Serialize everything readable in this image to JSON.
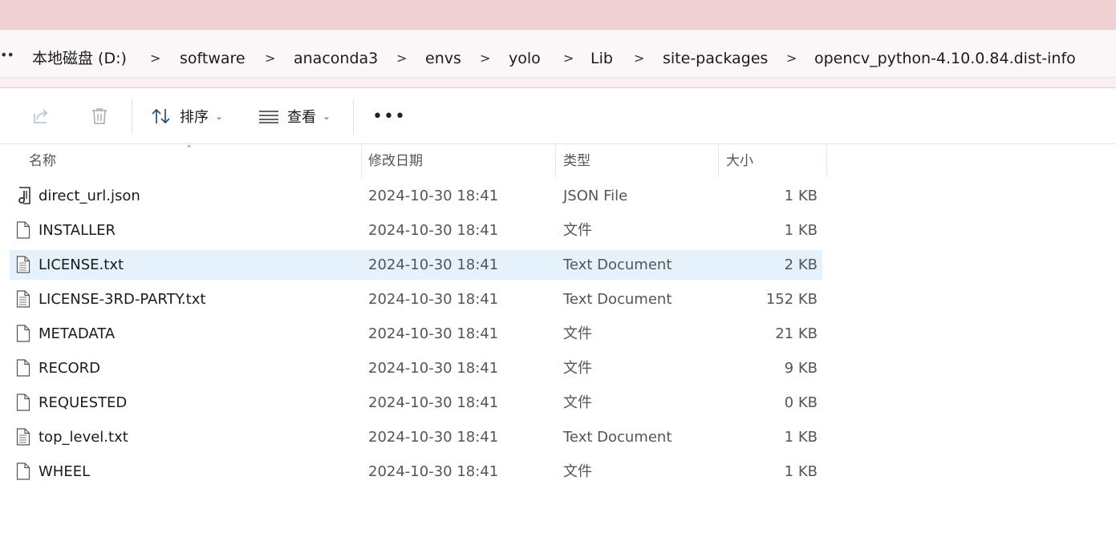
{
  "breadcrumb": {
    "overflow": "••",
    "separator": ">",
    "items": [
      "本地磁盘 (D:)",
      "software",
      "anaconda3",
      "envs",
      "yolo",
      "Lib",
      "site-packages",
      "opencv_python-4.10.0.84.dist-info"
    ]
  },
  "toolbar": {
    "share_icon": "share-icon",
    "delete_icon": "trash-icon",
    "sort_label": "排序",
    "view_label": "查看",
    "more_label": "•••"
  },
  "columns": {
    "name": "名称",
    "date": "修改日期",
    "type": "类型",
    "size": "大小"
  },
  "files": [
    {
      "name": "direct_url.json",
      "date": "2024-10-30 18:41",
      "type": "JSON File",
      "size": "1 KB",
      "icon": "json-file-icon"
    },
    {
      "name": "INSTALLER",
      "date": "2024-10-30 18:41",
      "type": "文件",
      "size": "1 KB",
      "icon": "file-icon"
    },
    {
      "name": "LICENSE.txt",
      "date": "2024-10-30 18:41",
      "type": "Text Document",
      "size": "2 KB",
      "icon": "text-file-icon",
      "selected": true
    },
    {
      "name": "LICENSE-3RD-PARTY.txt",
      "date": "2024-10-30 18:41",
      "type": "Text Document",
      "size": "152 KB",
      "icon": "text-file-icon"
    },
    {
      "name": "METADATA",
      "date": "2024-10-30 18:41",
      "type": "文件",
      "size": "21 KB",
      "icon": "file-icon"
    },
    {
      "name": "RECORD",
      "date": "2024-10-30 18:41",
      "type": "文件",
      "size": "9 KB",
      "icon": "file-icon"
    },
    {
      "name": "REQUESTED",
      "date": "2024-10-30 18:41",
      "type": "文件",
      "size": "0 KB",
      "icon": "file-icon"
    },
    {
      "name": "top_level.txt",
      "date": "2024-10-30 18:41",
      "type": "Text Document",
      "size": "1 KB",
      "icon": "text-file-icon"
    },
    {
      "name": "WHEEL",
      "date": "2024-10-30 18:41",
      "type": "文件",
      "size": "1 KB",
      "icon": "file-icon"
    }
  ],
  "colors": {
    "titlebar": "#efd1d4",
    "selected_row": "#e5f2fb"
  }
}
